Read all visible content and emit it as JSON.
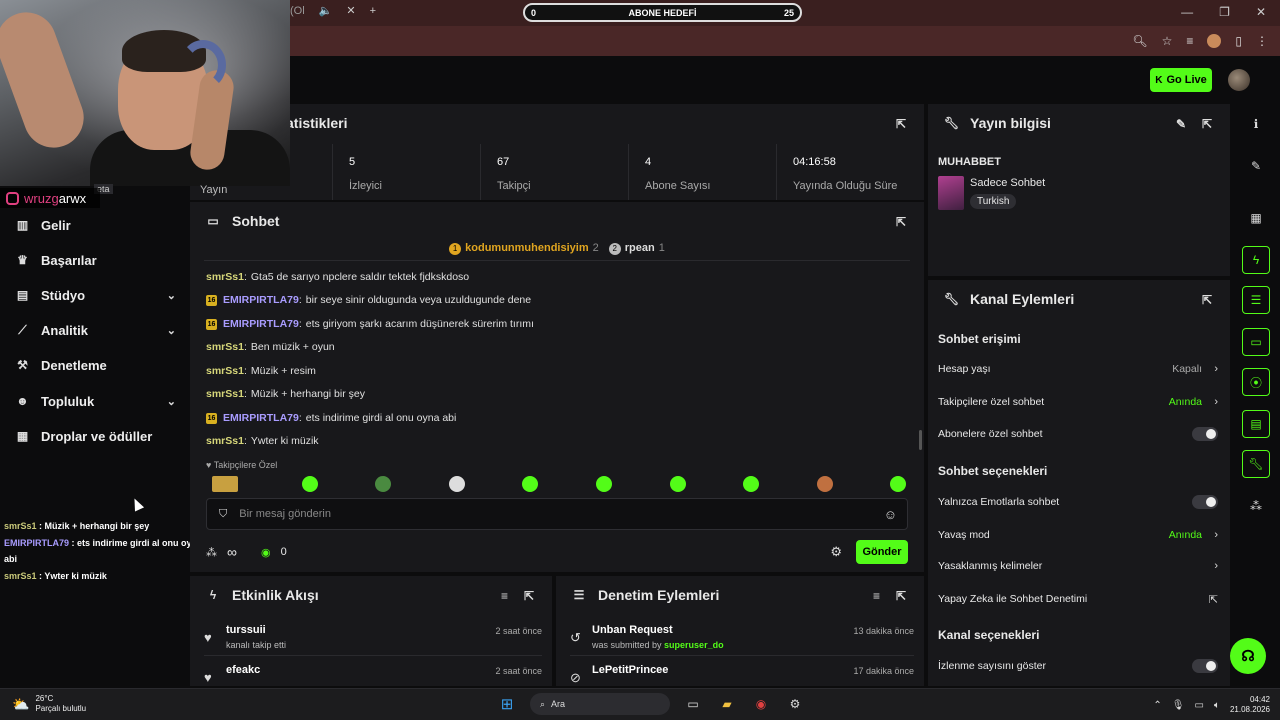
{
  "browser": {
    "tab_controls": [
      "(Ol",
      "🔈",
      "✕",
      "+"
    ],
    "goal_bar": {
      "start": "0",
      "title": "ABONE HEDEFİ",
      "end": "25",
      "progress": 0
    },
    "window_controls": [
      "—",
      "❐",
      "✕"
    ]
  },
  "header": {
    "go_live": "Go Live"
  },
  "overlay": {
    "instagram": {
      "prefix": "wruzg",
      "suffix": "arwx"
    },
    "yayin_label": "Yayın",
    "beta_fragment": "eta",
    "chat": [
      {
        "user": "smrSs1",
        "sep": " : ",
        "text": "Müzik + herhangi bir şey"
      },
      {
        "user": "EMIRPIRTLA79",
        "sep": " : ",
        "text": "ets indirime girdi al onu oyna abi"
      },
      {
        "user": "smrSs1",
        "sep": " : ",
        "text": "Ywter ki müzik"
      }
    ]
  },
  "sidebar": {
    "items": [
      {
        "label": "Gelir",
        "icon": "chart-bar-icon",
        "chevron": false
      },
      {
        "label": "Başarılar",
        "icon": "trophy-icon",
        "chevron": false
      },
      {
        "label": "Stüdyo",
        "icon": "studio-icon",
        "chevron": true
      },
      {
        "label": "Analitik",
        "icon": "analytics-icon",
        "chevron": true
      },
      {
        "label": "Denetleme",
        "icon": "hammer-icon",
        "chevron": false
      },
      {
        "label": "Topluluk",
        "icon": "users-icon",
        "chevron": true
      },
      {
        "label": "Droplar ve ödüller",
        "icon": "gift-icon",
        "chevron": false
      }
    ]
  },
  "stats": {
    "title": "atistikleri",
    "cells": [
      {
        "value": "5",
        "label": "İzleyici"
      },
      {
        "value": "67",
        "label": "Takipçi"
      },
      {
        "value": "4",
        "label": "Abone Sayısı"
      },
      {
        "value": "04:16:58",
        "label": "Yayında Olduğu Süre"
      }
    ]
  },
  "chat": {
    "title": "Sohbet",
    "pinned": [
      {
        "badge": "1",
        "name": "kodumunmuhendisiyim",
        "count": "2"
      },
      {
        "badge": "2",
        "name": "rpean",
        "count": "1"
      }
    ],
    "messages": [
      {
        "user": "smrSs1",
        "sub": false,
        "text": "Gta5 de sarıyo npclere saldır tektek fjdkskdoso"
      },
      {
        "user": "EMIRPIRTLA79",
        "sub": true,
        "text": "bir seye sinir oldugunda veya uzuldugunde dene"
      },
      {
        "user": "EMIRPIRTLA79",
        "sub": true,
        "text": "ets giriyom şarkı acarım düşünerek sürerim tırımı"
      },
      {
        "user": "smrSs1",
        "sub": false,
        "text": "Ben müzik + oyun"
      },
      {
        "user": "smrSs1",
        "sub": false,
        "text": "Müzik + resim"
      },
      {
        "user": "smrSs1",
        "sub": false,
        "text": "Müzik + herhangi bir şey"
      },
      {
        "user": "EMIRPIRTLA79",
        "sub": true,
        "text": "ets indirime girdi al onu oyna abi"
      },
      {
        "user": "smrSs1",
        "sub": false,
        "text": "Ywter ki müzik"
      }
    ],
    "sub_badge": "16",
    "followers_only_label": "Takipçilere Özel",
    "input_placeholder": "Bir mesaj gönderin",
    "points_infinity": "∞",
    "points_count": "0",
    "send_label": "Gönder"
  },
  "events": {
    "title": "Etkinlik Akışı",
    "rows": [
      {
        "name": "turssuii",
        "sub": "kanalı takip etti",
        "time": "2 saat önce"
      },
      {
        "name": "efeakc",
        "sub": "",
        "time": "2 saat önce"
      }
    ]
  },
  "moderation": {
    "title": "Denetim Eylemleri",
    "rows": [
      {
        "name": "Unban Request",
        "sub_prefix": "was submitted by",
        "sub_user": "superuser_do",
        "time": "13 dakika önce"
      },
      {
        "name": "LePetitPrincee",
        "sub_prefix": "",
        "sub_user": "",
        "time": "17 dakika önce"
      }
    ]
  },
  "stream_info": {
    "title": "Yayın bilgisi",
    "stream_title": "MUHABBET",
    "category": "Sadece Sohbet",
    "language": "Turkish"
  },
  "channel_actions": {
    "title": "Kanal Eylemleri",
    "section_access": "Sohbet erişimi",
    "account_age": {
      "label": "Hesap yaşı",
      "value": "Kapalı"
    },
    "followers_chat": {
      "label": "Takipçilere özel sohbet",
      "value": "Anında"
    },
    "subs_chat": {
      "label": "Abonelere özel sohbet"
    },
    "section_options": "Sohbet seçenekleri",
    "emote_only": {
      "label": "Yalnızca Emotlarla sohbet"
    },
    "slow_mode": {
      "label": "Yavaş mod",
      "value": "Anında"
    },
    "banned_words": {
      "label": "Yasaklanmış kelimeler"
    },
    "ai_moderation": {
      "label": "Yapay Zeka ile Sohbet Denetimi"
    },
    "section_channel": "Kanal seçenekleri",
    "show_viewers": {
      "label": "İzlenme sayısını göster"
    }
  },
  "taskbar": {
    "temp": "26°C",
    "weather": "Parçalı bulutlu",
    "search": "Ara",
    "time": "04:42",
    "date": "21.08.2026"
  },
  "colors": {
    "accent": "#53fc18",
    "panel": "#18181b",
    "background": "#0c0c0d"
  }
}
